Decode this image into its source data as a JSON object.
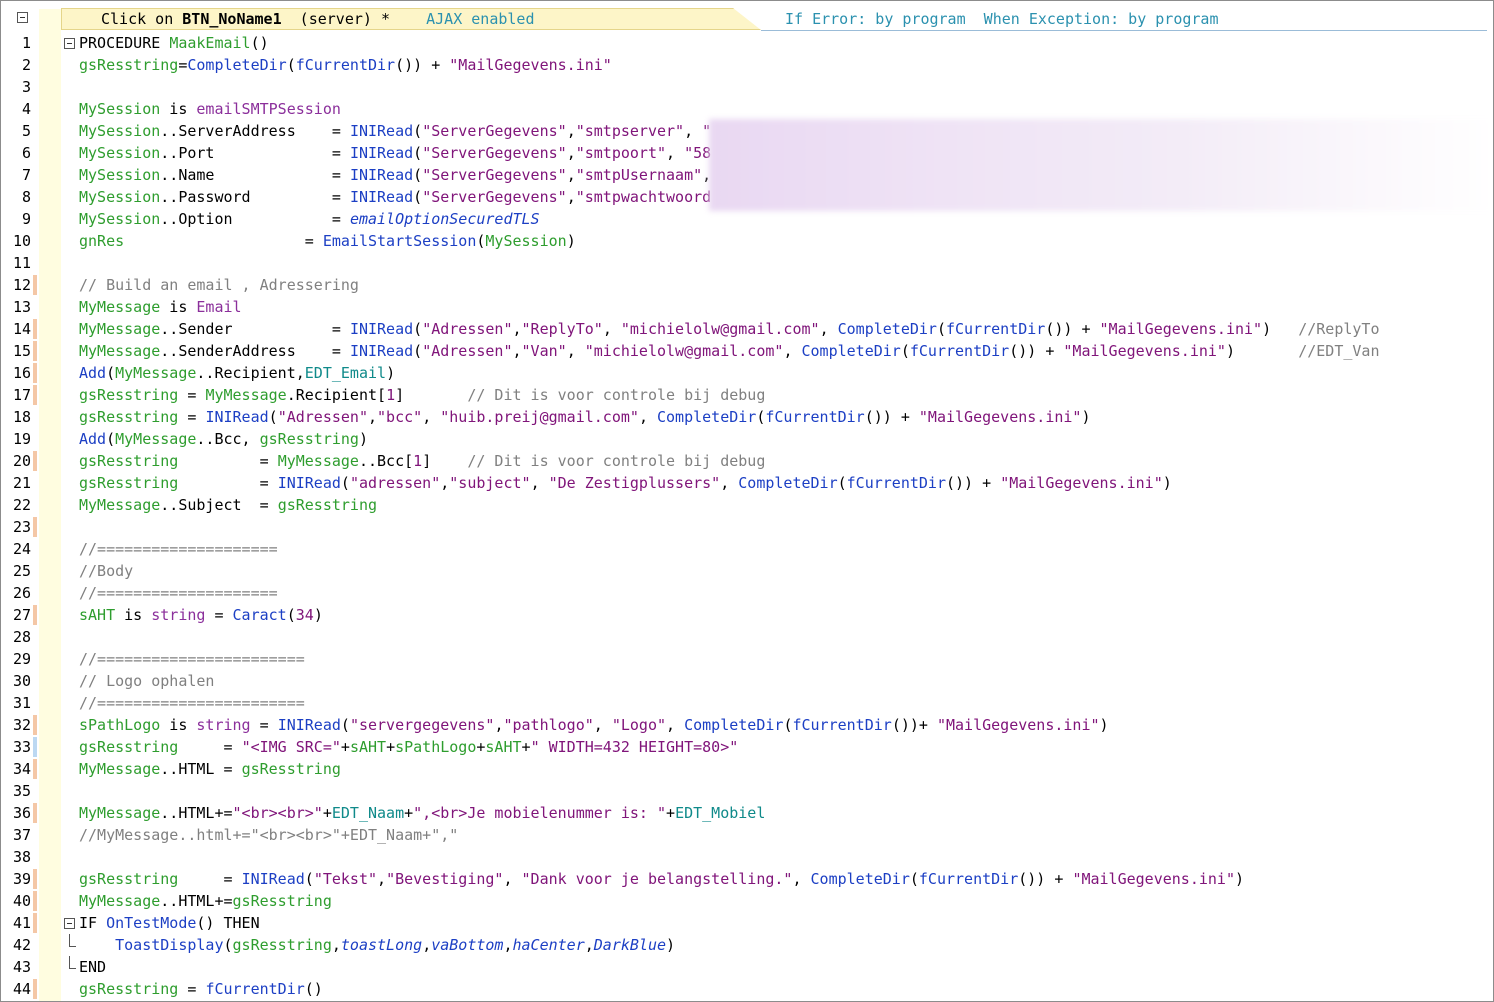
{
  "header": {
    "event_prefix": "Click on ",
    "event_control": "BTN_NoName1",
    "event_suffix": "  (server) *",
    "ajax": "AJAX enabled",
    "error_handling": "If Error: by program  When Exception: by program"
  },
  "lines": [
    {
      "n": "1",
      "mark": "none",
      "fold": "open",
      "segs": [
        [
          "kw",
          "PROCEDURE "
        ],
        [
          "g",
          "MaakEmail"
        ],
        [
          "kw",
          "()"
        ]
      ]
    },
    {
      "n": "2",
      "mark": "none",
      "fold": "line",
      "segs": [
        [
          "g",
          "gsResstring"
        ],
        [
          "kw",
          "="
        ],
        [
          "fn",
          "CompleteDir"
        ],
        [
          "kw",
          "("
        ],
        [
          "fn",
          "fCurrentDir"
        ],
        [
          "kw",
          "()) + "
        ],
        [
          "st",
          "\"MailGegevens.ini\""
        ]
      ]
    },
    {
      "n": "3",
      "mark": "none",
      "fold": "line",
      "segs": []
    },
    {
      "n": "4",
      "mark": "none",
      "fold": "line",
      "segs": [
        [
          "g",
          "MySession"
        ],
        [
          "kw",
          " is "
        ],
        [
          "ty",
          "emailSMTPSession"
        ]
      ]
    },
    {
      "n": "5",
      "mark": "none",
      "fold": "line",
      "segs": [
        [
          "g",
          "MySession"
        ],
        [
          "kw",
          "..ServerAddress    = "
        ],
        [
          "fn",
          "INIRead"
        ],
        [
          "kw",
          "("
        ],
        [
          "st",
          "\"ServerGegevens\""
        ],
        [
          "kw",
          ","
        ],
        [
          "st",
          "\"smtpserver\""
        ],
        [
          "kw",
          ", "
        ],
        [
          "st",
          "\""
        ]
      ]
    },
    {
      "n": "6",
      "mark": "none",
      "fold": "line",
      "segs": [
        [
          "g",
          "MySession"
        ],
        [
          "kw",
          "..Port             = "
        ],
        [
          "fn",
          "INIRead"
        ],
        [
          "kw",
          "("
        ],
        [
          "st",
          "\"ServerGegevens\""
        ],
        [
          "kw",
          ","
        ],
        [
          "st",
          "\"smtpoort\""
        ],
        [
          "kw",
          ", "
        ],
        [
          "st",
          "\"58"
        ]
      ]
    },
    {
      "n": "7",
      "mark": "none",
      "fold": "line",
      "segs": [
        [
          "g",
          "MySession"
        ],
        [
          "kw",
          "..Name             = "
        ],
        [
          "fn",
          "INIRead"
        ],
        [
          "kw",
          "("
        ],
        [
          "st",
          "\"ServerGegevens\""
        ],
        [
          "kw",
          ","
        ],
        [
          "st",
          "\"smtpUsernaam\""
        ],
        [
          "kw",
          ","
        ]
      ]
    },
    {
      "n": "8",
      "mark": "none",
      "fold": "line",
      "segs": [
        [
          "g",
          "MySession"
        ],
        [
          "kw",
          "..Password         = "
        ],
        [
          "fn",
          "INIRead"
        ],
        [
          "kw",
          "("
        ],
        [
          "st",
          "\"ServerGegevens\""
        ],
        [
          "kw",
          ","
        ],
        [
          "st",
          "\"smtpwachtwoord"
        ]
      ]
    },
    {
      "n": "9",
      "mark": "none",
      "fold": "line",
      "segs": [
        [
          "g",
          "MySession"
        ],
        [
          "kw",
          "..Option           = "
        ],
        [
          "ci",
          "emailOptionSecuredTLS"
        ]
      ]
    },
    {
      "n": "10",
      "mark": "none",
      "fold": "line",
      "segs": [
        [
          "g",
          "gnRes"
        ],
        [
          "kw",
          "                    = "
        ],
        [
          "fn",
          "EmailStartSession"
        ],
        [
          "kw",
          "("
        ],
        [
          "g",
          "MySession"
        ],
        [
          "kw",
          ")"
        ]
      ]
    },
    {
      "n": "11",
      "mark": "none",
      "fold": "line",
      "segs": []
    },
    {
      "n": "12",
      "mark": "orange",
      "fold": "line",
      "segs": [
        [
          "cm",
          "// Build an email , Adressering"
        ]
      ]
    },
    {
      "n": "13",
      "mark": "none",
      "fold": "line",
      "segs": [
        [
          "g",
          "MyMessage"
        ],
        [
          "kw",
          " is "
        ],
        [
          "ty",
          "Email"
        ]
      ]
    },
    {
      "n": "14",
      "mark": "orange",
      "fold": "line",
      "segs": [
        [
          "g",
          "MyMessage"
        ],
        [
          "kw",
          "..Sender           = "
        ],
        [
          "fn",
          "INIRead"
        ],
        [
          "kw",
          "("
        ],
        [
          "st",
          "\"Adressen\""
        ],
        [
          "kw",
          ","
        ],
        [
          "st",
          "\"ReplyTo\""
        ],
        [
          "kw",
          ", "
        ],
        [
          "st",
          "\"michielolw@gmail.com\""
        ],
        [
          "kw",
          ", "
        ],
        [
          "fn",
          "CompleteDir"
        ],
        [
          "kw",
          "("
        ],
        [
          "fn",
          "fCurrentDir"
        ],
        [
          "kw",
          "()) + "
        ],
        [
          "st",
          "\"MailGegevens.ini\""
        ],
        [
          "kw",
          ")   "
        ],
        [
          "cm",
          "//ReplyTo"
        ]
      ]
    },
    {
      "n": "15",
      "mark": "orange",
      "fold": "line",
      "segs": [
        [
          "g",
          "MyMessage"
        ],
        [
          "kw",
          "..SenderAddress    = "
        ],
        [
          "fn",
          "INIRead"
        ],
        [
          "kw",
          "("
        ],
        [
          "st",
          "\"Adressen\""
        ],
        [
          "kw",
          ","
        ],
        [
          "st",
          "\"Van\""
        ],
        [
          "kw",
          ", "
        ],
        [
          "st",
          "\"michielolw@gmail.com\""
        ],
        [
          "kw",
          ", "
        ],
        [
          "fn",
          "CompleteDir"
        ],
        [
          "kw",
          "("
        ],
        [
          "fn",
          "fCurrentDir"
        ],
        [
          "kw",
          "()) + "
        ],
        [
          "st",
          "\"MailGegevens.ini\""
        ],
        [
          "kw",
          ")       "
        ],
        [
          "cm",
          "//EDT_Van"
        ]
      ]
    },
    {
      "n": "16",
      "mark": "orange",
      "fold": "line",
      "segs": [
        [
          "fn",
          "Add"
        ],
        [
          "kw",
          "("
        ],
        [
          "g",
          "MyMessage"
        ],
        [
          "kw",
          "..Recipient,"
        ],
        [
          "ct",
          "EDT_Email"
        ],
        [
          "kw",
          ")"
        ]
      ]
    },
    {
      "n": "17",
      "mark": "orange",
      "fold": "line",
      "segs": [
        [
          "g",
          "gsResstring"
        ],
        [
          "kw",
          " = "
        ],
        [
          "g",
          "MyMessage"
        ],
        [
          "kw",
          ".Recipient["
        ],
        [
          "nm",
          "1"
        ],
        [
          "kw",
          "]       "
        ],
        [
          "cm",
          "// Dit is voor controle bij debug"
        ]
      ]
    },
    {
      "n": "18",
      "mark": "none",
      "fold": "line",
      "segs": [
        [
          "g",
          "gsResstring"
        ],
        [
          "kw",
          " = "
        ],
        [
          "fn",
          "INIRead"
        ],
        [
          "kw",
          "("
        ],
        [
          "st",
          "\"Adressen\""
        ],
        [
          "kw",
          ","
        ],
        [
          "st",
          "\"bcc\""
        ],
        [
          "kw",
          ", "
        ],
        [
          "st",
          "\"huib.preij@gmail.com\""
        ],
        [
          "kw",
          ", "
        ],
        [
          "fn",
          "CompleteDir"
        ],
        [
          "kw",
          "("
        ],
        [
          "fn",
          "fCurrentDir"
        ],
        [
          "kw",
          "()) + "
        ],
        [
          "st",
          "\"MailGegevens.ini\""
        ],
        [
          "kw",
          ")"
        ]
      ]
    },
    {
      "n": "19",
      "mark": "none",
      "fold": "line",
      "segs": [
        [
          "fn",
          "Add"
        ],
        [
          "kw",
          "("
        ],
        [
          "g",
          "MyMessage"
        ],
        [
          "kw",
          "..Bcc, "
        ],
        [
          "g",
          "gsResstring"
        ],
        [
          "kw",
          ")"
        ]
      ]
    },
    {
      "n": "20",
      "mark": "orange",
      "fold": "line",
      "segs": [
        [
          "g",
          "gsResstring"
        ],
        [
          "kw",
          "         = "
        ],
        [
          "g",
          "MyMessage"
        ],
        [
          "kw",
          "..Bcc["
        ],
        [
          "nm",
          "1"
        ],
        [
          "kw",
          "]    "
        ],
        [
          "cm",
          "// Dit is voor controle bij debug"
        ]
      ]
    },
    {
      "n": "21",
      "mark": "none",
      "fold": "line",
      "segs": [
        [
          "g",
          "gsResstring"
        ],
        [
          "kw",
          "         = "
        ],
        [
          "fn",
          "INIRead"
        ],
        [
          "kw",
          "("
        ],
        [
          "st",
          "\"adressen\""
        ],
        [
          "kw",
          ","
        ],
        [
          "st",
          "\"subject\""
        ],
        [
          "kw",
          ", "
        ],
        [
          "st",
          "\"De Zestigplussers\""
        ],
        [
          "kw",
          ", "
        ],
        [
          "fn",
          "CompleteDir"
        ],
        [
          "kw",
          "("
        ],
        [
          "fn",
          "fCurrentDir"
        ],
        [
          "kw",
          "()) + "
        ],
        [
          "st",
          "\"MailGegevens.ini\""
        ],
        [
          "kw",
          ")"
        ]
      ]
    },
    {
      "n": "22",
      "mark": "none",
      "fold": "line",
      "segs": [
        [
          "g",
          "MyMessage"
        ],
        [
          "kw",
          "..Subject  = "
        ],
        [
          "g",
          "gsResstring"
        ]
      ]
    },
    {
      "n": "23",
      "mark": "orange",
      "fold": "line",
      "segs": []
    },
    {
      "n": "24",
      "mark": "none",
      "fold": "line",
      "segs": [
        [
          "cm",
          "//===================="
        ]
      ]
    },
    {
      "n": "25",
      "mark": "none",
      "fold": "line",
      "segs": [
        [
          "cm",
          "//Body"
        ]
      ]
    },
    {
      "n": "26",
      "mark": "none",
      "fold": "line",
      "segs": [
        [
          "cm",
          "//===================="
        ]
      ]
    },
    {
      "n": "27",
      "mark": "orange",
      "fold": "line",
      "segs": [
        [
          "g",
          "sAHT"
        ],
        [
          "kw",
          " is "
        ],
        [
          "ty",
          "string"
        ],
        [
          "kw",
          " = "
        ],
        [
          "fn",
          "Caract"
        ],
        [
          "kw",
          "("
        ],
        [
          "nm",
          "34"
        ],
        [
          "kw",
          ")"
        ]
      ]
    },
    {
      "n": "28",
      "mark": "none",
      "fold": "line",
      "segs": []
    },
    {
      "n": "29",
      "mark": "none",
      "fold": "line",
      "segs": [
        [
          "cm",
          "//======================="
        ]
      ]
    },
    {
      "n": "30",
      "mark": "none",
      "fold": "line",
      "segs": [
        [
          "cm",
          "// Logo ophalen"
        ]
      ]
    },
    {
      "n": "31",
      "mark": "none",
      "fold": "line",
      "segs": [
        [
          "cm",
          "//======================="
        ]
      ]
    },
    {
      "n": "32",
      "mark": "orange",
      "fold": "line",
      "segs": [
        [
          "g",
          "sPathLogo"
        ],
        [
          "kw",
          " is "
        ],
        [
          "ty",
          "string"
        ],
        [
          "kw",
          " = "
        ],
        [
          "fn",
          "INIRead"
        ],
        [
          "kw",
          "("
        ],
        [
          "st",
          "\"servergegevens\""
        ],
        [
          "kw",
          ","
        ],
        [
          "st",
          "\"pathlogo\""
        ],
        [
          "kw",
          ", "
        ],
        [
          "st",
          "\"Logo\""
        ],
        [
          "kw",
          ", "
        ],
        [
          "fn",
          "CompleteDir"
        ],
        [
          "kw",
          "("
        ],
        [
          "fn",
          "fCurrentDir"
        ],
        [
          "kw",
          "())+ "
        ],
        [
          "st",
          "\"MailGegevens.ini\""
        ],
        [
          "kw",
          ")"
        ]
      ]
    },
    {
      "n": "33",
      "mark": "blue",
      "fold": "line",
      "segs": [
        [
          "g",
          "gsResstring"
        ],
        [
          "kw",
          "     = "
        ],
        [
          "st",
          "\"<IMG SRC=\""
        ],
        [
          "kw",
          "+"
        ],
        [
          "g",
          "sAHT"
        ],
        [
          "kw",
          "+"
        ],
        [
          "g",
          "sPathLogo"
        ],
        [
          "kw",
          "+"
        ],
        [
          "g",
          "sAHT"
        ],
        [
          "kw",
          "+"
        ],
        [
          "st",
          "\" WIDTH=432 HEIGHT=80>\""
        ]
      ]
    },
    {
      "n": "34",
      "mark": "orange",
      "fold": "line",
      "segs": [
        [
          "g",
          "MyMessage"
        ],
        [
          "kw",
          "..HTML = "
        ],
        [
          "g",
          "gsResstring"
        ]
      ]
    },
    {
      "n": "35",
      "mark": "none",
      "fold": "line",
      "segs": []
    },
    {
      "n": "36",
      "mark": "orange",
      "fold": "line",
      "segs": [
        [
          "g",
          "MyMessage"
        ],
        [
          "kw",
          "..HTML+="
        ],
        [
          "st",
          "\"<br><br>\""
        ],
        [
          "kw",
          "+"
        ],
        [
          "ct",
          "EDT_Naam"
        ],
        [
          "kw",
          "+"
        ],
        [
          "st",
          "\",<br>Je mobielenummer is: \""
        ],
        [
          "kw",
          "+"
        ],
        [
          "ct",
          "EDT_Mobiel"
        ]
      ]
    },
    {
      "n": "37",
      "mark": "none",
      "fold": "line",
      "segs": [
        [
          "cm",
          "//MyMessage..html+=\"<br><br>\"+EDT_Naam+\",\""
        ]
      ]
    },
    {
      "n": "38",
      "mark": "none",
      "fold": "line",
      "segs": []
    },
    {
      "n": "39",
      "mark": "orange",
      "fold": "line",
      "segs": [
        [
          "g",
          "gsResstring"
        ],
        [
          "kw",
          "     = "
        ],
        [
          "fn",
          "INIRead"
        ],
        [
          "kw",
          "("
        ],
        [
          "st",
          "\"Tekst\""
        ],
        [
          "kw",
          ","
        ],
        [
          "st",
          "\"Bevestiging\""
        ],
        [
          "kw",
          ", "
        ],
        [
          "st",
          "\"Dank voor je belangstelling.\""
        ],
        [
          "kw",
          ", "
        ],
        [
          "fn",
          "CompleteDir"
        ],
        [
          "kw",
          "("
        ],
        [
          "fn",
          "fCurrentDir"
        ],
        [
          "kw",
          "()) + "
        ],
        [
          "st",
          "\"MailGegevens.ini\""
        ],
        [
          "kw",
          ")"
        ]
      ]
    },
    {
      "n": "40",
      "mark": "orange",
      "fold": "line",
      "segs": [
        [
          "g",
          "MyMessage"
        ],
        [
          "kw",
          "..HTML+="
        ],
        [
          "g",
          "gsResstring"
        ]
      ]
    },
    {
      "n": "41",
      "mark": "orange",
      "fold": "open",
      "segs": [
        [
          "kw",
          "IF "
        ],
        [
          "fn",
          "OnTestMode"
        ],
        [
          "kw",
          "() THEN"
        ]
      ]
    },
    {
      "n": "42",
      "mark": "none",
      "fold": "end",
      "segs": [
        [
          "kw",
          "    "
        ],
        [
          "fn",
          "ToastDisplay"
        ],
        [
          "kw",
          "("
        ],
        [
          "g",
          "gsResstring"
        ],
        [
          "kw",
          ","
        ],
        [
          "ci",
          "toastLong"
        ],
        [
          "kw",
          ","
        ],
        [
          "ci",
          "vaBottom"
        ],
        [
          "kw",
          ","
        ],
        [
          "ci",
          "haCenter"
        ],
        [
          "kw",
          ","
        ],
        [
          "ci",
          "DarkBlue"
        ],
        [
          "kw",
          ")"
        ]
      ]
    },
    {
      "n": "43",
      "mark": "none",
      "fold": "end",
      "segs": [
        [
          "kw",
          "END"
        ]
      ]
    },
    {
      "n": "44",
      "mark": "orange",
      "fold": "line",
      "segs": [
        [
          "g",
          "gsResstring"
        ],
        [
          "kw",
          " = "
        ],
        [
          "fn",
          "fCurrentDir"
        ],
        [
          "kw",
          "()"
        ]
      ]
    }
  ]
}
